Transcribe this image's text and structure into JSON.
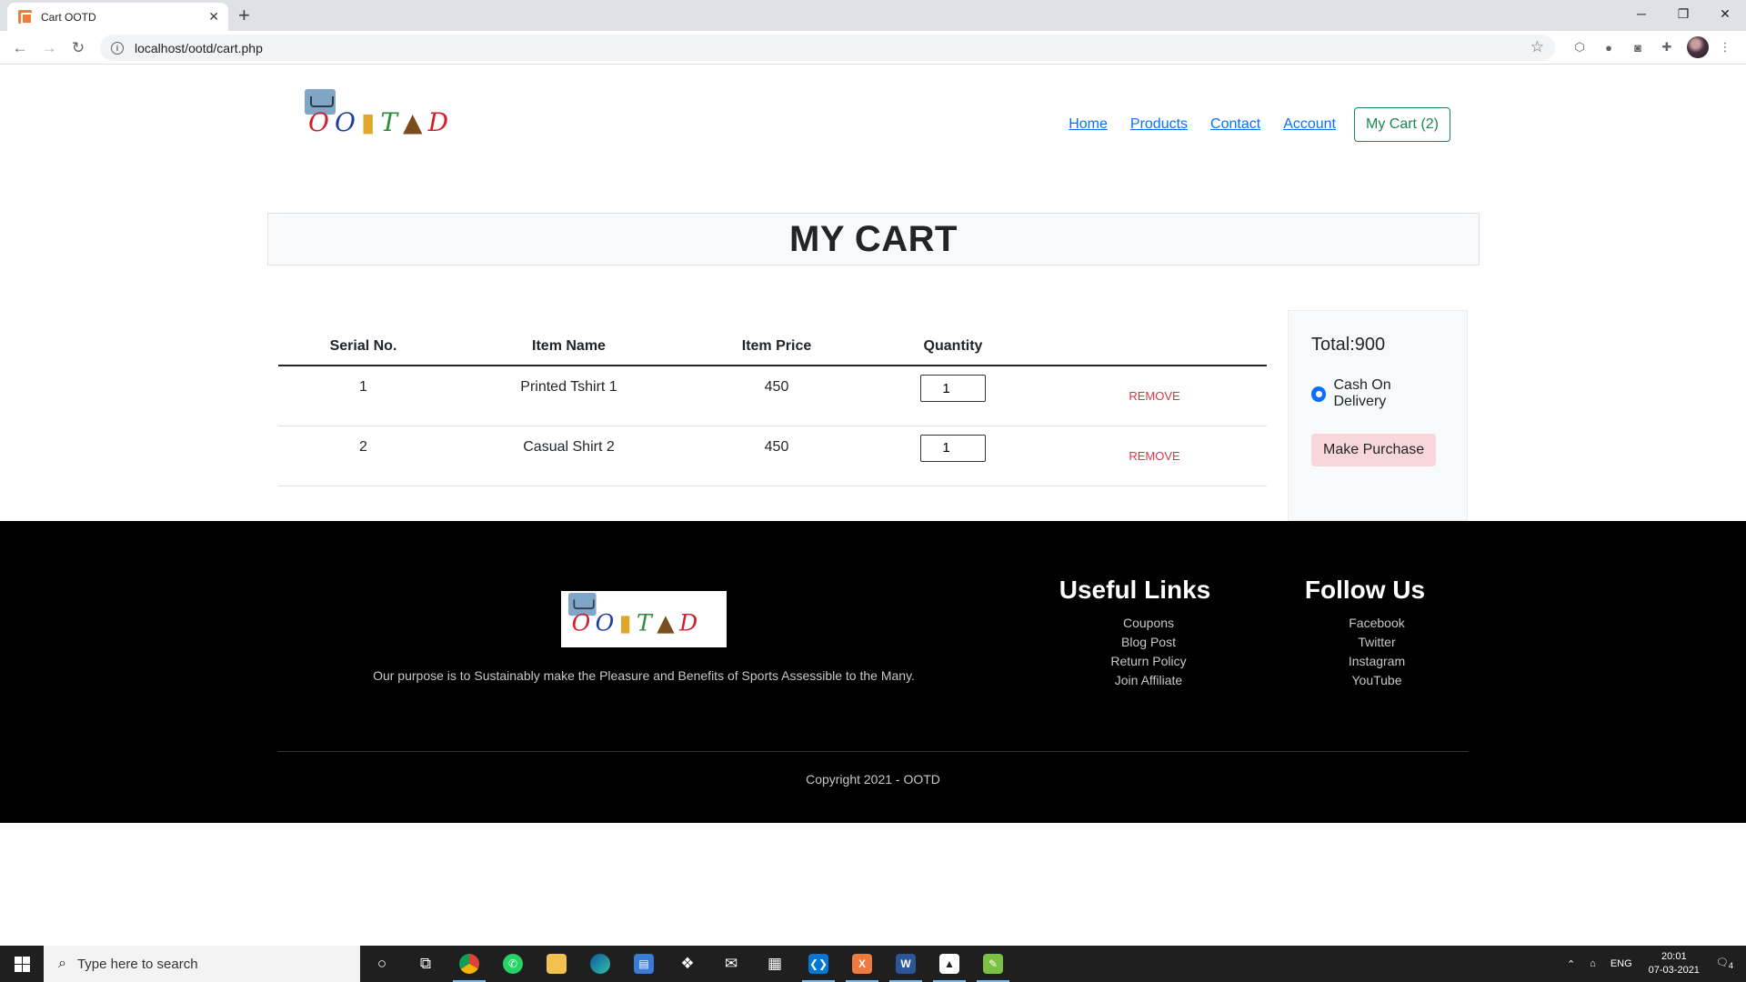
{
  "browser": {
    "tab_title": "Cart OOTD",
    "tab_close": "✕",
    "new_tab": "+",
    "url": "localhost/ootd/cart.php"
  },
  "site": {
    "logo_text": "OOTD",
    "nav": {
      "home": "Home",
      "products": "Products",
      "contact": "Contact",
      "account": "Account",
      "cart": "My Cart (2)"
    }
  },
  "page": {
    "title": "MY CART",
    "table": {
      "headers": [
        "Serial No.",
        "Item Name",
        "Item Price",
        "Quantity",
        ""
      ],
      "rows": [
        {
          "serial": "1",
          "name": "Printed Tshirt 1",
          "price": "450",
          "quantity": "1",
          "action": "REMOVE"
        },
        {
          "serial": "2",
          "name": "Casual Shirt 2",
          "price": "450",
          "quantity": "1",
          "action": "REMOVE"
        }
      ]
    },
    "summary": {
      "total": "Total:900",
      "payment_option": "Cash On Delivery",
      "purchase_button": "Make Purchase"
    }
  },
  "footer": {
    "purpose": "Our purpose is to Sustainably make the Pleasure and Benefits of Sports Assessible to the Many.",
    "useful_links": {
      "heading": "Useful Links",
      "items": [
        "Coupons",
        "Blog Post",
        "Return Policy",
        "Join Affiliate"
      ]
    },
    "follow_us": {
      "heading": "Follow Us",
      "items": [
        "Facebook",
        "Twitter",
        "Instagram",
        "YouTube"
      ]
    },
    "copyright": "Copyright 2021 - OOTD"
  },
  "taskbar": {
    "search_placeholder": "Type here to search",
    "language": "ENG",
    "time": "20:01",
    "date": "07-03-2021",
    "notifications": "4"
  },
  "colors": {
    "link": "#0d6efd",
    "cart_button": "#198754",
    "remove": "#dc3545",
    "purchase_button_bg": "#f8d7da",
    "footer_bg": "#000000"
  }
}
